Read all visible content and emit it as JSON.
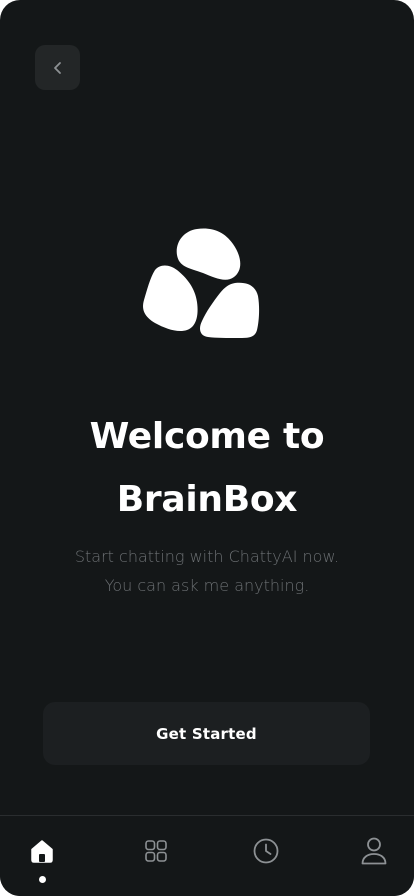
{
  "header": {
    "back_icon": "chevron-left-icon"
  },
  "logo": {
    "icon": "brainbox-logo-icon",
    "color": "#ffffff"
  },
  "welcome": {
    "title_line1": "Welcome to",
    "title_line2": "BrainBox",
    "subtitle_line1": "Start chatting with ChattyAI now.",
    "subtitle_line2": "You can ask me anything."
  },
  "cta": {
    "label": "Get Started"
  },
  "tab_bar": {
    "items": [
      {
        "icon": "home-icon",
        "active": true
      },
      {
        "icon": "grid-icon",
        "active": false
      },
      {
        "icon": "clock-icon",
        "active": false
      },
      {
        "icon": "user-icon",
        "active": false
      }
    ]
  },
  "colors": {
    "background": "#141718",
    "surface": "#232627",
    "button": "#1c1f21",
    "text": "#ffffff",
    "muted_text": "#6b6f72",
    "icon_inactive": "#8d9194"
  }
}
